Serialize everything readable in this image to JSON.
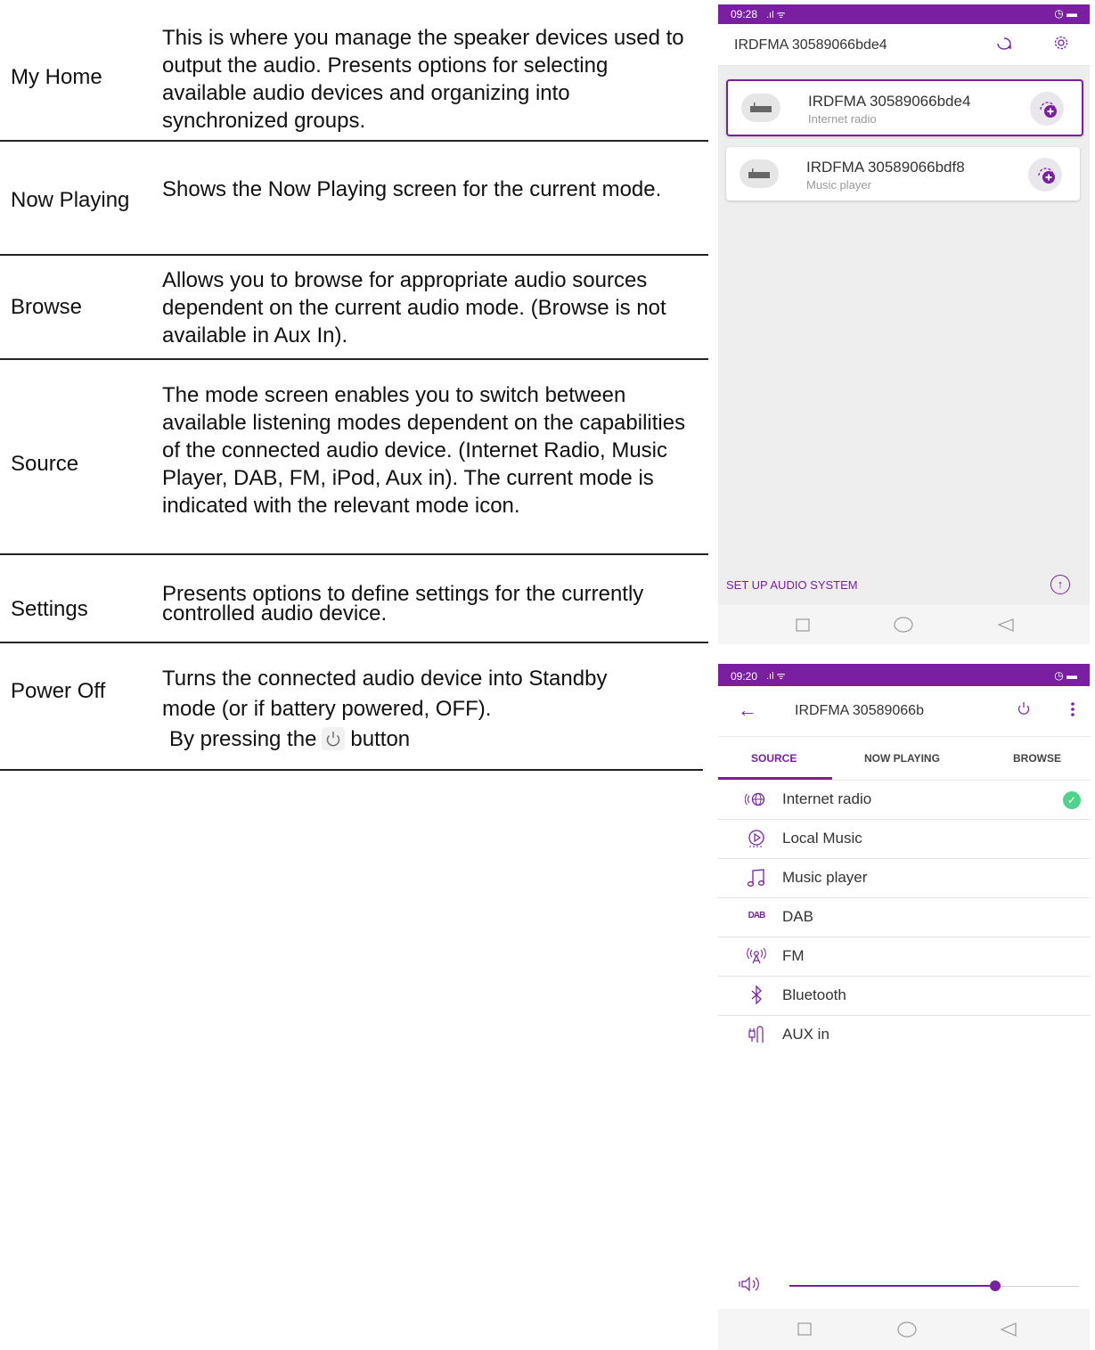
{
  "table": {
    "rows": [
      {
        "name": "My Home",
        "desc": "This is where you manage the speaker devices used to output the audio. Presents options for selecting available audio devices and organizing into synchronized groups."
      },
      {
        "name": "Now Playing",
        "desc": "Shows the Now Playing screen for the current mode."
      },
      {
        "name": "Browse",
        "desc": "Allows you to browse for appropriate audio sources dependent on the current audio mode. (Browse is not available in Aux In)."
      },
      {
        "name": "Source",
        "desc": "The mode screen enables you to switch between available listening modes dependent on the capabilities of the connected audio device. (Internet Radio, Music Player, DAB, FM, iPod, Aux in). The current mode is indicated with the relevant mode icon."
      },
      {
        "name": "Settings",
        "desc": "Presents options to define settings for the currently controlled audio device."
      },
      {
        "name": "Power Off",
        "desc_line1": "Turns the connected audio device into Standby",
        "desc_line2": "mode (or if battery powered, OFF).",
        "desc_line3_pre": "By pressing the",
        "desc_line3_post": "button"
      }
    ]
  },
  "phone_home": {
    "status_time": "09:28",
    "title": "IRDFMA 30589066bde4",
    "devices": [
      {
        "name": "IRDFMA 30589066bde4",
        "mode": "Internet radio",
        "selected": true
      },
      {
        "name": "IRDFMA 30589066bdf8",
        "mode": "Music player",
        "selected": false
      }
    ],
    "setup_label": "SET UP AUDIO SYSTEM"
  },
  "phone_source": {
    "status_time": "09:20",
    "title": "IRDFMA 30589066b",
    "tabs": [
      "SOURCE",
      "NOW PLAYING",
      "BROWSE"
    ],
    "active_tab": "SOURCE",
    "sources": [
      {
        "label": "Internet radio",
        "icon": "globe-radio-icon",
        "active": true
      },
      {
        "label": "Local Music",
        "icon": "local-music-icon",
        "active": false
      },
      {
        "label": "Music player",
        "icon": "music-note-icon",
        "active": false
      },
      {
        "label": "DAB",
        "icon": "dab-icon",
        "active": false
      },
      {
        "label": "FM",
        "icon": "fm-antenna-icon",
        "active": false
      },
      {
        "label": "Bluetooth",
        "icon": "bluetooth-icon",
        "active": false
      },
      {
        "label": "AUX in",
        "icon": "aux-cable-icon",
        "active": false
      }
    ],
    "volume_level": 0.71
  },
  "colors": {
    "accent": "#7a1fa2",
    "check": "#4fd38a"
  }
}
